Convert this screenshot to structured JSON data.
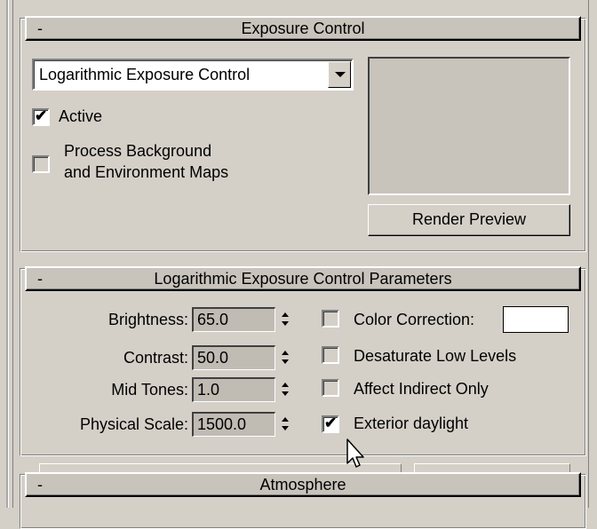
{
  "exposure_rollout": {
    "collapse_symbol": "-",
    "title": "Exposure Control",
    "exposure_type": "Logarithmic Exposure Control",
    "active_label": "Active",
    "active_checked": true,
    "process_bg_label_line1": "Process Background",
    "process_bg_label_line2": "and Environment Maps",
    "process_bg_checked": false,
    "render_preview_label": "Render Preview"
  },
  "params_rollout": {
    "collapse_symbol": "-",
    "title": "Logarithmic Exposure Control Parameters",
    "fields": [
      {
        "label": "Brightness:",
        "value": "65.0"
      },
      {
        "label": "Contrast:",
        "value": "50.0"
      },
      {
        "label": "Mid Tones:",
        "value": "1.0"
      },
      {
        "label": "Physical Scale:",
        "value": "1500.0"
      }
    ],
    "checks": [
      {
        "label": "Color Correction:",
        "checked": false
      },
      {
        "label": "Desaturate Low Levels",
        "checked": false
      },
      {
        "label": "Affect Indirect Only",
        "checked": false
      },
      {
        "label": "Exterior daylight",
        "checked": true
      }
    ],
    "color_correction_swatch": "#ffffff"
  },
  "atmosphere_rollout": {
    "collapse_symbol": "-",
    "title": "Atmosphere"
  },
  "check_mark": "✔"
}
